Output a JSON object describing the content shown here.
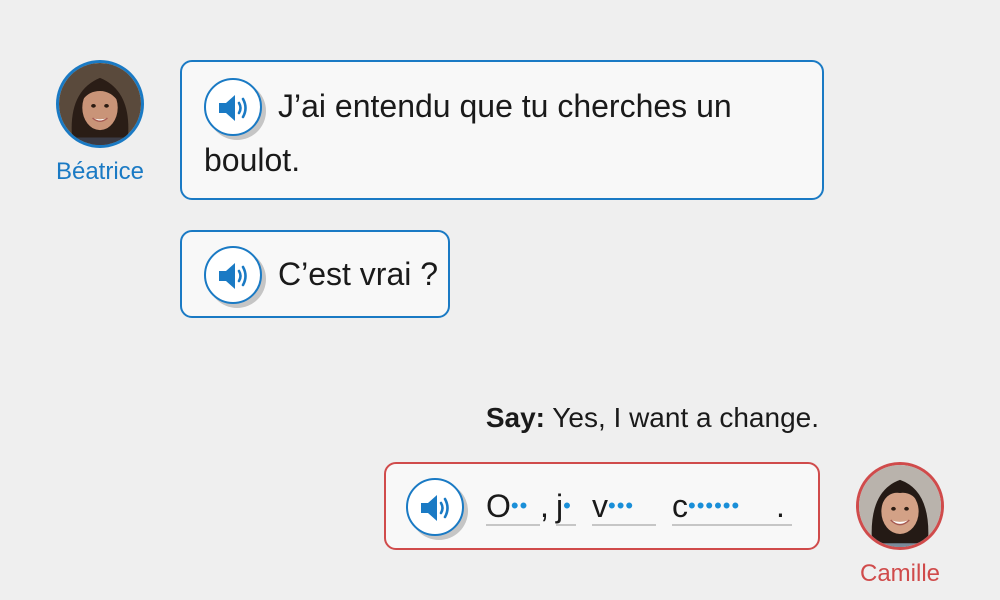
{
  "conversation": {
    "speaker1": {
      "name": "Béatrice",
      "color": "#1a7ac4",
      "messages": [
        {
          "line1": "J’ai entendu que tu cherches un",
          "line2": "boulot.",
          "audio_icon": "speaker-icon"
        },
        {
          "line1": "C’est vrai ?",
          "audio_icon": "speaker-icon"
        }
      ]
    },
    "prompt": {
      "label": "Say:",
      "text": "Yes, I want a change."
    },
    "speaker2": {
      "name": "Camille",
      "color": "#d04b4b",
      "answer": {
        "audio_icon": "speaker-icon",
        "words": [
          {
            "letter": "O",
            "dots": "••"
          },
          {
            "letter": "j",
            "dots": "•"
          },
          {
            "letter": "v",
            "dots": "•••"
          },
          {
            "letter": "c",
            "dots": "••••••"
          }
        ],
        "comma": ",",
        "period": "."
      }
    }
  }
}
